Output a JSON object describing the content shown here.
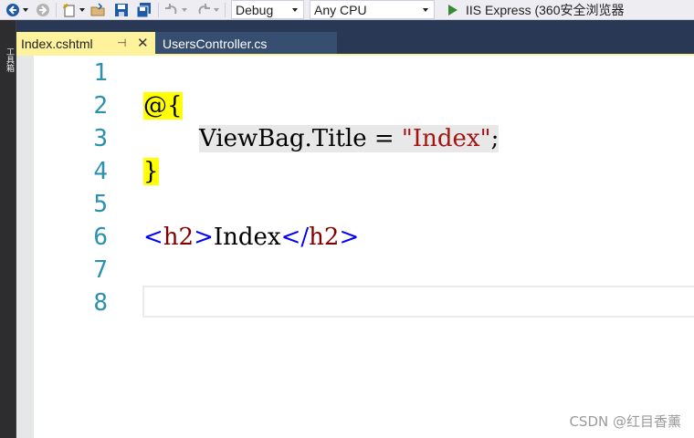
{
  "toolbar": {
    "config_value": "Debug",
    "platform_value": "Any CPU",
    "run_label": "IIS Express (360安全浏览器"
  },
  "side_panel": {
    "label": "工具箱"
  },
  "tabs": [
    {
      "label": "Index.cshtml",
      "active": true
    },
    {
      "label": "UsersController.cs",
      "active": false
    }
  ],
  "editor": {
    "line_numbers": [
      "1",
      "2",
      "3",
      "4",
      "5",
      "6",
      "7",
      "8"
    ],
    "code": {
      "line2": "@{",
      "line3_a": "ViewBag.Title = ",
      "line3_str": "\"Index\"",
      "line3_end": ";",
      "line4": "}",
      "line6_lt1": "<",
      "line6_tag1": "h2",
      "line6_gt1": ">",
      "line6_text": "Index",
      "line6_lt2": "</",
      "line6_tag2": "h2",
      "line6_gt2": ">"
    }
  },
  "watermark": "CSDN @红目香薰",
  "colors": {
    "tab_active": "#fff29d",
    "tab_bar": "#293955",
    "line_number": "#2b91af",
    "string": "#a31515",
    "html_tag": "#800000",
    "html_bracket": "#0000ff",
    "razor_highlight": "#ffff00"
  }
}
